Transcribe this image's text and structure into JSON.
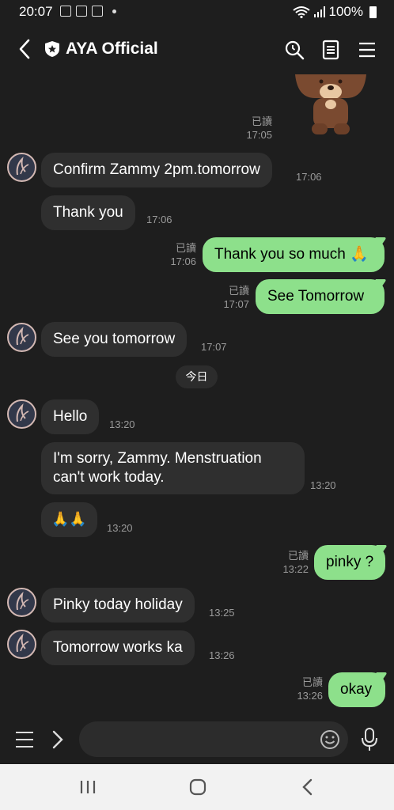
{
  "status": {
    "time": "20:07",
    "battery": "100%"
  },
  "header": {
    "title": "AYA Official"
  },
  "messages": {
    "m1": {
      "read": "已讀",
      "time": "17:05"
    },
    "m2": {
      "text": "Confirm Zammy 2pm.tomorrow",
      "time": "17:06"
    },
    "m3": {
      "text": "Thank you",
      "time": "17:06"
    },
    "m4": {
      "text": "Thank you so much 🙏",
      "read": "已讀",
      "time": "17:06"
    },
    "m5": {
      "text": "See Tomorrow",
      "read": "已讀",
      "time": "17:07"
    },
    "m6": {
      "text": "See you tomorrow",
      "time": "17:07"
    },
    "date": "今日",
    "m7": {
      "text": "Hello",
      "time": "13:20"
    },
    "m8": {
      "line1": "I'm sorry, Zammy.  Menstruation",
      "line2": "can't work today.",
      "time": "13:20"
    },
    "m9": {
      "text": "🙏🙏",
      "time": "13:20"
    },
    "m10": {
      "text": "pinky ?",
      "read": "已讀",
      "time": "13:22"
    },
    "m11": {
      "text": "Pinky today holiday",
      "time": "13:25"
    },
    "m12": {
      "text": "Tomorrow works ka",
      "time": "13:26"
    },
    "m13": {
      "text": "okay",
      "read": "已讀",
      "time": "13:26"
    }
  },
  "input": {
    "placeholder": ""
  },
  "colors": {
    "background": "#1e1e1e",
    "incoming": "#2f2f2f",
    "outgoing": "#8de08b",
    "meta": "#9a9a9a"
  }
}
